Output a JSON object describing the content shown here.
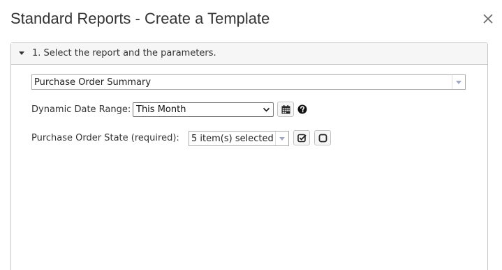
{
  "dialog": {
    "title": "Standard Reports - Create a Template",
    "close_icon": "close-icon"
  },
  "section": {
    "title": "1. Select the report and the parameters.",
    "expanded": true
  },
  "report_select": {
    "value": "Purchase Order Summary"
  },
  "date_range": {
    "label": "Dynamic Date Range:",
    "value": "This Month",
    "calendar_icon": "calendar-icon",
    "help_icon": "question-circle-icon"
  },
  "po_state": {
    "label": "Purchase Order State (required):",
    "value": "5 item(s) selected",
    "select_all_icon": "check-square-icon",
    "deselect_all_icon": "square-icon"
  },
  "colors": {
    "panel_header_bg": "#f6f6f6",
    "border": "#c5c5c5",
    "text": "#333333",
    "dropdown_arrow": "#a0a8c8"
  }
}
